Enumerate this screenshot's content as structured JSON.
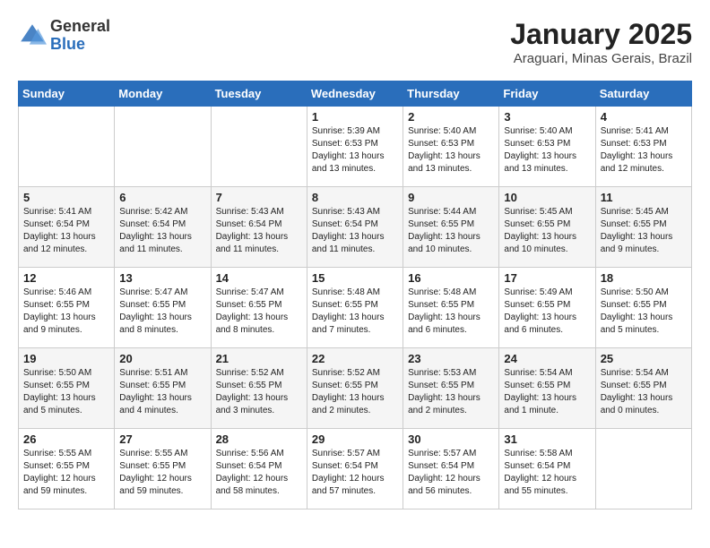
{
  "logo": {
    "general": "General",
    "blue": "Blue"
  },
  "title": {
    "month_year": "January 2025",
    "location": "Araguari, Minas Gerais, Brazil"
  },
  "headers": [
    "Sunday",
    "Monday",
    "Tuesday",
    "Wednesday",
    "Thursday",
    "Friday",
    "Saturday"
  ],
  "weeks": [
    [
      {
        "day": "",
        "info": ""
      },
      {
        "day": "",
        "info": ""
      },
      {
        "day": "",
        "info": ""
      },
      {
        "day": "1",
        "info": "Sunrise: 5:39 AM\nSunset: 6:53 PM\nDaylight: 13 hours\nand 13 minutes."
      },
      {
        "day": "2",
        "info": "Sunrise: 5:40 AM\nSunset: 6:53 PM\nDaylight: 13 hours\nand 13 minutes."
      },
      {
        "day": "3",
        "info": "Sunrise: 5:40 AM\nSunset: 6:53 PM\nDaylight: 13 hours\nand 13 minutes."
      },
      {
        "day": "4",
        "info": "Sunrise: 5:41 AM\nSunset: 6:53 PM\nDaylight: 13 hours\nand 12 minutes."
      }
    ],
    [
      {
        "day": "5",
        "info": "Sunrise: 5:41 AM\nSunset: 6:54 PM\nDaylight: 13 hours\nand 12 minutes."
      },
      {
        "day": "6",
        "info": "Sunrise: 5:42 AM\nSunset: 6:54 PM\nDaylight: 13 hours\nand 11 minutes."
      },
      {
        "day": "7",
        "info": "Sunrise: 5:43 AM\nSunset: 6:54 PM\nDaylight: 13 hours\nand 11 minutes."
      },
      {
        "day": "8",
        "info": "Sunrise: 5:43 AM\nSunset: 6:54 PM\nDaylight: 13 hours\nand 11 minutes."
      },
      {
        "day": "9",
        "info": "Sunrise: 5:44 AM\nSunset: 6:55 PM\nDaylight: 13 hours\nand 10 minutes."
      },
      {
        "day": "10",
        "info": "Sunrise: 5:45 AM\nSunset: 6:55 PM\nDaylight: 13 hours\nand 10 minutes."
      },
      {
        "day": "11",
        "info": "Sunrise: 5:45 AM\nSunset: 6:55 PM\nDaylight: 13 hours\nand 9 minutes."
      }
    ],
    [
      {
        "day": "12",
        "info": "Sunrise: 5:46 AM\nSunset: 6:55 PM\nDaylight: 13 hours\nand 9 minutes."
      },
      {
        "day": "13",
        "info": "Sunrise: 5:47 AM\nSunset: 6:55 PM\nDaylight: 13 hours\nand 8 minutes."
      },
      {
        "day": "14",
        "info": "Sunrise: 5:47 AM\nSunset: 6:55 PM\nDaylight: 13 hours\nand 8 minutes."
      },
      {
        "day": "15",
        "info": "Sunrise: 5:48 AM\nSunset: 6:55 PM\nDaylight: 13 hours\nand 7 minutes."
      },
      {
        "day": "16",
        "info": "Sunrise: 5:48 AM\nSunset: 6:55 PM\nDaylight: 13 hours\nand 6 minutes."
      },
      {
        "day": "17",
        "info": "Sunrise: 5:49 AM\nSunset: 6:55 PM\nDaylight: 13 hours\nand 6 minutes."
      },
      {
        "day": "18",
        "info": "Sunrise: 5:50 AM\nSunset: 6:55 PM\nDaylight: 13 hours\nand 5 minutes."
      }
    ],
    [
      {
        "day": "19",
        "info": "Sunrise: 5:50 AM\nSunset: 6:55 PM\nDaylight: 13 hours\nand 5 minutes."
      },
      {
        "day": "20",
        "info": "Sunrise: 5:51 AM\nSunset: 6:55 PM\nDaylight: 13 hours\nand 4 minutes."
      },
      {
        "day": "21",
        "info": "Sunrise: 5:52 AM\nSunset: 6:55 PM\nDaylight: 13 hours\nand 3 minutes."
      },
      {
        "day": "22",
        "info": "Sunrise: 5:52 AM\nSunset: 6:55 PM\nDaylight: 13 hours\nand 2 minutes."
      },
      {
        "day": "23",
        "info": "Sunrise: 5:53 AM\nSunset: 6:55 PM\nDaylight: 13 hours\nand 2 minutes."
      },
      {
        "day": "24",
        "info": "Sunrise: 5:54 AM\nSunset: 6:55 PM\nDaylight: 13 hours\nand 1 minute."
      },
      {
        "day": "25",
        "info": "Sunrise: 5:54 AM\nSunset: 6:55 PM\nDaylight: 13 hours\nand 0 minutes."
      }
    ],
    [
      {
        "day": "26",
        "info": "Sunrise: 5:55 AM\nSunset: 6:55 PM\nDaylight: 12 hours\nand 59 minutes."
      },
      {
        "day": "27",
        "info": "Sunrise: 5:55 AM\nSunset: 6:55 PM\nDaylight: 12 hours\nand 59 minutes."
      },
      {
        "day": "28",
        "info": "Sunrise: 5:56 AM\nSunset: 6:54 PM\nDaylight: 12 hours\nand 58 minutes."
      },
      {
        "day": "29",
        "info": "Sunrise: 5:57 AM\nSunset: 6:54 PM\nDaylight: 12 hours\nand 57 minutes."
      },
      {
        "day": "30",
        "info": "Sunrise: 5:57 AM\nSunset: 6:54 PM\nDaylight: 12 hours\nand 56 minutes."
      },
      {
        "day": "31",
        "info": "Sunrise: 5:58 AM\nSunset: 6:54 PM\nDaylight: 12 hours\nand 55 minutes."
      },
      {
        "day": "",
        "info": ""
      }
    ]
  ]
}
